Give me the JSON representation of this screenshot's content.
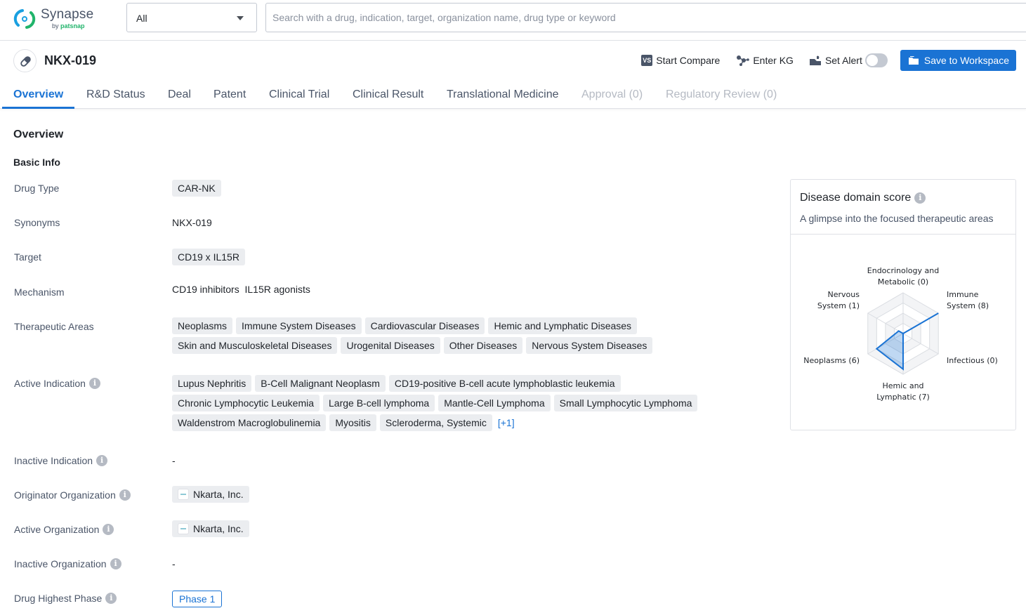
{
  "header": {
    "logo": {
      "brand": "Synapse",
      "by": "by",
      "company": "patsnap"
    },
    "search_scope": {
      "selected": "All"
    },
    "search": {
      "placeholder": "Search with a drug, indication, target, organization name, drug type or keyword",
      "value": ""
    }
  },
  "drug": {
    "name": "NKX-019",
    "actions": {
      "compare_label": "Start Compare",
      "compare_icon_text": "VS",
      "kg_label": "Enter KG",
      "alert_label": "Set Alert",
      "alert_enabled": false,
      "save_label": "Save to Workspace"
    }
  },
  "tabs": [
    {
      "label": "Overview",
      "state": "active"
    },
    {
      "label": "R&D Status",
      "state": "normal"
    },
    {
      "label": "Deal",
      "state": "normal"
    },
    {
      "label": "Patent",
      "state": "normal"
    },
    {
      "label": "Clinical Trial",
      "state": "normal"
    },
    {
      "label": "Clinical Result",
      "state": "normal"
    },
    {
      "label": "Translational Medicine",
      "state": "normal"
    },
    {
      "label": "Approval (0)",
      "state": "disabled"
    },
    {
      "label": "Regulatory Review (0)",
      "state": "disabled"
    }
  ],
  "overview": {
    "title": "Overview",
    "basic_info_title": "Basic Info",
    "fields": {
      "drug_type": {
        "label": "Drug Type",
        "tags": [
          "CAR-NK"
        ]
      },
      "synonyms": {
        "label": "Synonyms",
        "value": "NKX-019"
      },
      "target": {
        "label": "Target",
        "tags": [
          "CD19 x IL15R"
        ]
      },
      "mechanism": {
        "label": "Mechanism",
        "value": "CD19 inhibitors  IL15R agonists"
      },
      "therapeutic_areas": {
        "label": "Therapeutic Areas",
        "tags": [
          "Neoplasms",
          "Immune System Diseases",
          "Cardiovascular Diseases",
          "Hemic and Lymphatic Diseases",
          "Skin and Musculoskeletal Diseases",
          "Urogenital Diseases",
          "Other Diseases",
          "Nervous System Diseases"
        ]
      },
      "active_indication": {
        "label": "Active Indication",
        "tags": [
          "Lupus Nephritis",
          "B-Cell Malignant Neoplasm",
          "CD19-positive B-cell acute lymphoblastic leukemia",
          "Chronic Lymphocytic Leukemia",
          "Large B-cell lymphoma",
          "Mantle-Cell Lymphoma",
          "Small Lymphocytic Lymphoma",
          "Waldenstrom Macroglobulinemia",
          "Myositis",
          "Scleroderma, Systemic"
        ],
        "more": "[+1]"
      },
      "inactive_indication": {
        "label": "Inactive Indication",
        "value": "-"
      },
      "originator_org": {
        "label": "Originator Organization",
        "org": "Nkarta, Inc."
      },
      "active_org": {
        "label": "Active Organization",
        "org": "Nkarta, Inc."
      },
      "inactive_org": {
        "label": "Inactive Organization",
        "value": "-"
      },
      "highest_phase": {
        "label": "Drug Highest Phase",
        "value": "Phase 1"
      }
    }
  },
  "disease_domain": {
    "title": "Disease domain score",
    "subtitle": "A glimpse into the focused therapeutic areas",
    "accent": "#1a73d4"
  },
  "chart_data": {
    "type": "radar",
    "title": "Disease domain score",
    "axes": [
      {
        "label_lines": [
          "Endocrinology and",
          "Metabolic (0)"
        ],
        "name": "Endocrinology and Metabolic",
        "value": 0
      },
      {
        "label_lines": [
          "Immune",
          "System (8)"
        ],
        "name": "Immune System",
        "value": 8
      },
      {
        "label_lines": [
          "Infectious (0)"
        ],
        "name": "Infectious",
        "value": 0
      },
      {
        "label_lines": [
          "Hemic and",
          "Lymphatic (7)"
        ],
        "name": "Hemic and Lymphatic",
        "value": 7
      },
      {
        "label_lines": [
          "Neoplasms (6)"
        ],
        "name": "Neoplasms",
        "value": 6
      },
      {
        "label_lines": [
          "Nervous",
          "System (1)"
        ],
        "name": "Nervous System",
        "value": 1
      }
    ],
    "max": 8,
    "grid_levels": 4
  }
}
